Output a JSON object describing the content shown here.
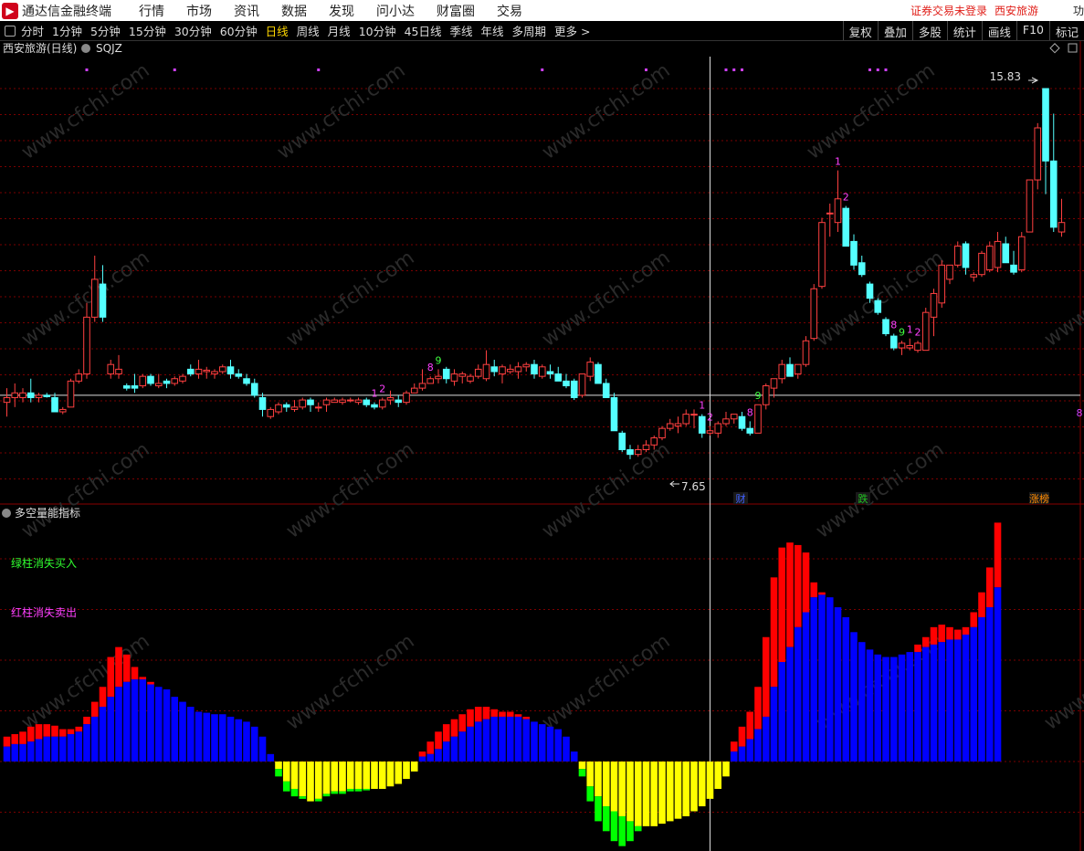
{
  "app": {
    "name": "通达信金融终端",
    "logo": "logo-icon"
  },
  "menu": [
    "行情",
    "市场",
    "资讯",
    "数据",
    "发现",
    "问小达",
    "财富圈",
    "交易"
  ],
  "status": {
    "login": "证券交易未登录",
    "stock": "西安旅游",
    "cut": "功"
  },
  "periods": [
    "分时",
    "1分钟",
    "5分钟",
    "15分钟",
    "30分钟",
    "60分钟",
    "日线",
    "周线",
    "月线",
    "10分钟",
    "45日线",
    "季线",
    "年线",
    "多周期",
    "更多 >"
  ],
  "active_period": "日线",
  "tools": [
    "复权",
    "叠加",
    "多股",
    "统计",
    "画线",
    "F10",
    "标记"
  ],
  "main_panel": {
    "title": "西安旅游(日线)",
    "indicator": "SQJZ",
    "high_label": "15.83",
    "low_label": "7.65",
    "markers": [
      "财",
      "跌",
      "涨榜"
    ],
    "right_edge_label": "8"
  },
  "sub_panel": {
    "title": "多空量能指标",
    "legend_green": "绿柱消失买入",
    "legend_red": "红柱消失卖出"
  },
  "watermark": "www.cfchi.com",
  "colors": {
    "up": "#ff4040",
    "down": "#54ffff",
    "bar_red": "#ff0000",
    "bar_blue": "#0000ff",
    "bar_yellow": "#ffff00",
    "bar_green": "#00ff00",
    "active": "#ffd700",
    "grid": "#7a0000"
  },
  "chart_data": {
    "type": "candlestick",
    "candles": [
      [
        9.2,
        9.5,
        8.9,
        9.3
      ],
      [
        9.3,
        9.6,
        9.1,
        9.4
      ],
      [
        9.3,
        9.5,
        9.2,
        9.4
      ],
      [
        9.4,
        9.7,
        9.2,
        9.3
      ],
      [
        9.3,
        9.4,
        9.2,
        9.35
      ],
      [
        9.35,
        9.4,
        9.3,
        9.32
      ],
      [
        9.3,
        9.4,
        9.0,
        9.0
      ],
      [
        9.0,
        9.1,
        8.95,
        9.05
      ],
      [
        9.1,
        9.7,
        9.1,
        9.65
      ],
      [
        9.65,
        9.9,
        9.6,
        9.8
      ],
      [
        9.8,
        11.3,
        9.7,
        11.0
      ],
      [
        11.0,
        12.3,
        10.9,
        11.8
      ],
      [
        11.7,
        12.1,
        10.9,
        11.0
      ],
      [
        9.8,
        10.1,
        9.7,
        10.0
      ],
      [
        9.8,
        10.2,
        9.7,
        9.9
      ],
      [
        9.55,
        9.6,
        9.45,
        9.5
      ],
      [
        9.55,
        9.8,
        9.4,
        9.5
      ],
      [
        9.55,
        9.8,
        9.5,
        9.75
      ],
      [
        9.75,
        9.8,
        9.55,
        9.6
      ],
      [
        9.55,
        9.8,
        9.5,
        9.6
      ],
      [
        9.65,
        9.7,
        9.5,
        9.6
      ],
      [
        9.6,
        9.75,
        9.55,
        9.7
      ],
      [
        9.65,
        9.8,
        9.6,
        9.75
      ],
      [
        9.9,
        10.0,
        9.75,
        9.8
      ],
      [
        9.8,
        10.1,
        9.7,
        9.9
      ],
      [
        9.85,
        9.95,
        9.7,
        9.88
      ],
      [
        9.8,
        9.9,
        9.7,
        9.85
      ],
      [
        9.85,
        10.0,
        9.8,
        9.95
      ],
      [
        9.95,
        10.1,
        9.7,
        9.8
      ],
      [
        9.8,
        9.9,
        9.7,
        9.75
      ],
      [
        9.7,
        9.8,
        9.55,
        9.6
      ],
      [
        9.6,
        9.7,
        9.3,
        9.35
      ],
      [
        9.3,
        9.4,
        8.9,
        9.05
      ],
      [
        8.9,
        9.1,
        8.85,
        9.05
      ],
      [
        9.0,
        9.2,
        8.95,
        9.15
      ],
      [
        9.15,
        9.2,
        9.0,
        9.1
      ],
      [
        9.05,
        9.25,
        9.0,
        9.1
      ],
      [
        9.1,
        9.3,
        9.05,
        9.25
      ],
      [
        9.25,
        9.3,
        9.0,
        9.15
      ],
      [
        9.1,
        9.2,
        9.0,
        9.1
      ],
      [
        9.15,
        9.3,
        9.0,
        9.25
      ],
      [
        9.2,
        9.3,
        9.2,
        9.25
      ],
      [
        9.2,
        9.3,
        9.15,
        9.25
      ],
      [
        9.25,
        9.3,
        9.2,
        9.25
      ],
      [
        9.2,
        9.3,
        9.15,
        9.25
      ],
      [
        9.25,
        9.3,
        9.1,
        9.15
      ],
      [
        9.15,
        9.2,
        9.05,
        9.1
      ],
      [
        9.1,
        9.3,
        9.05,
        9.25
      ],
      [
        9.25,
        9.45,
        9.15,
        9.3
      ],
      [
        9.25,
        9.35,
        9.1,
        9.2
      ],
      [
        9.2,
        9.45,
        9.15,
        9.4
      ],
      [
        9.4,
        9.6,
        9.4,
        9.5
      ],
      [
        9.5,
        9.9,
        9.45,
        9.6
      ],
      [
        9.6,
        9.75,
        9.6,
        9.7
      ],
      [
        9.7,
        9.9,
        9.6,
        9.75
      ],
      [
        9.9,
        9.95,
        9.6,
        9.7
      ],
      [
        9.65,
        9.9,
        9.55,
        9.8
      ],
      [
        9.75,
        9.85,
        9.6,
        9.8
      ],
      [
        9.65,
        9.8,
        9.6,
        9.75
      ],
      [
        9.75,
        10.0,
        9.7,
        9.9
      ],
      [
        9.7,
        10.3,
        9.65,
        10.0
      ],
      [
        9.95,
        10.1,
        9.75,
        9.85
      ],
      [
        9.8,
        10.0,
        9.6,
        9.95
      ],
      [
        9.85,
        10.0,
        9.8,
        9.9
      ],
      [
        9.85,
        10.05,
        9.7,
        9.95
      ],
      [
        9.95,
        10.05,
        9.85,
        10.0
      ],
      [
        10.0,
        10.1,
        9.7,
        9.8
      ],
      [
        9.75,
        10.0,
        9.7,
        9.95
      ],
      [
        9.85,
        10.0,
        9.7,
        9.8
      ],
      [
        9.8,
        9.95,
        9.65,
        9.65
      ],
      [
        9.65,
        9.8,
        9.5,
        9.55
      ],
      [
        9.65,
        9.7,
        9.25,
        9.3
      ],
      [
        9.35,
        9.8,
        9.3,
        9.8
      ],
      [
        9.75,
        10.15,
        9.65,
        10.05
      ],
      [
        10.0,
        10.05,
        9.6,
        9.6
      ],
      [
        9.6,
        9.7,
        9.3,
        9.3
      ],
      [
        9.3,
        9.4,
        8.6,
        8.6
      ],
      [
        8.55,
        8.6,
        8.15,
        8.2
      ],
      [
        8.2,
        8.3,
        8.0,
        8.1
      ],
      [
        8.1,
        8.3,
        8.05,
        8.2
      ],
      [
        8.2,
        8.4,
        8.15,
        8.3
      ],
      [
        8.3,
        8.5,
        8.2,
        8.45
      ],
      [
        8.45,
        8.7,
        8.4,
        8.65
      ],
      [
        8.65,
        8.85,
        8.6,
        8.75
      ],
      [
        8.7,
        8.9,
        8.55,
        8.75
      ],
      [
        8.75,
        9.05,
        8.7,
        8.95
      ],
      [
        8.95,
        9.05,
        8.65,
        8.95
      ],
      [
        8.9,
        8.95,
        8.45,
        8.55
      ],
      [
        8.55,
        8.7,
        8.5,
        8.6
      ],
      [
        8.55,
        8.8,
        8.45,
        8.75
      ],
      [
        8.75,
        9.0,
        8.7,
        8.85
      ],
      [
        8.85,
        8.95,
        8.75,
        8.95
      ],
      [
        8.9,
        9.0,
        8.6,
        8.65
      ],
      [
        8.65,
        8.8,
        8.5,
        8.55
      ],
      [
        8.55,
        9.15,
        8.55,
        9.15
      ],
      [
        9.15,
        9.6,
        9.05,
        9.55
      ],
      [
        9.5,
        9.7,
        9.3,
        9.7
      ],
      [
        9.7,
        10.1,
        9.6,
        10.0
      ],
      [
        10.0,
        10.15,
        9.75,
        9.75
      ],
      [
        9.8,
        10.0,
        9.7,
        10.0
      ],
      [
        10.0,
        10.6,
        9.95,
        10.5
      ],
      [
        10.55,
        11.7,
        10.5,
        11.6
      ],
      [
        11.65,
        13.1,
        11.6,
        13.0
      ],
      [
        13.2,
        13.4,
        12.7,
        13.2
      ],
      [
        13.0,
        14.1,
        12.8,
        13.5
      ],
      [
        13.3,
        13.35,
        12.5,
        12.5
      ],
      [
        12.6,
        12.75,
        12.0,
        12.1
      ],
      [
        12.15,
        12.3,
        11.85,
        11.9
      ],
      [
        11.7,
        11.75,
        11.3,
        11.4
      ],
      [
        11.35,
        11.4,
        11.05,
        11.1
      ],
      [
        10.95,
        11.0,
        10.6,
        10.65
      ],
      [
        10.6,
        10.65,
        10.3,
        10.35
      ],
      [
        10.35,
        10.5,
        10.2,
        10.45
      ],
      [
        10.35,
        10.55,
        10.3,
        10.4
      ],
      [
        10.3,
        10.5,
        10.25,
        10.45
      ],
      [
        10.3,
        11.2,
        10.3,
        11.1
      ],
      [
        11.0,
        11.6,
        10.6,
        11.5
      ],
      [
        11.3,
        12.2,
        11.2,
        12.1
      ],
      [
        11.8,
        12.1,
        11.7,
        12.1
      ],
      [
        12.1,
        12.6,
        12.05,
        12.5
      ],
      [
        12.55,
        12.6,
        11.9,
        12.05
      ],
      [
        11.85,
        11.95,
        11.75,
        11.9
      ],
      [
        11.9,
        12.4,
        11.85,
        12.35
      ],
      [
        12.0,
        12.6,
        11.95,
        12.5
      ],
      [
        12.05,
        12.8,
        11.95,
        12.6
      ],
      [
        12.55,
        12.7,
        12.15,
        12.15
      ],
      [
        12.1,
        12.4,
        11.9,
        11.95
      ],
      [
        12.0,
        12.8,
        11.95,
        12.7
      ],
      [
        12.8,
        13.9,
        12.8,
        13.9
      ],
      [
        13.9,
        15.1,
        13.7,
        15.0
      ],
      [
        15.83,
        15.83,
        13.6,
        14.3
      ],
      [
        14.3,
        15.3,
        12.8,
        12.9
      ],
      [
        12.8,
        13.5,
        12.7,
        13.0
      ]
    ],
    "x_label_marks": [
      {
        "i": 46,
        "t": "1",
        "c": "#ff40ff"
      },
      {
        "i": 47,
        "t": "2",
        "c": "#ff40ff"
      },
      {
        "i": 53,
        "t": "8",
        "c": "#ff40ff"
      },
      {
        "i": 54,
        "t": "9",
        "c": "#40ff40"
      },
      {
        "i": 87,
        "t": "1",
        "c": "#ff40ff"
      },
      {
        "i": 88,
        "t": "2",
        "c": "#ff40ff"
      },
      {
        "i": 93,
        "t": "8",
        "c": "#ff40ff"
      },
      {
        "i": 94,
        "t": "9",
        "c": "#40ff40"
      },
      {
        "i": 104,
        "t": "1",
        "c": "#ff40ff"
      },
      {
        "i": 105,
        "t": "2",
        "c": "#ff40ff"
      },
      {
        "i": 111,
        "t": "8",
        "c": "#ff40ff"
      },
      {
        "i": 112,
        "t": "9",
        "c": "#40ff40"
      },
      {
        "i": 113,
        "t": "1",
        "c": "#ff40ff"
      },
      {
        "i": 114,
        "t": "2",
        "c": "#ff40ff"
      }
    ],
    "top_dots": [
      10,
      21,
      39,
      67,
      80,
      90,
      91,
      92,
      108,
      109,
      110
    ],
    "price_line": 9.35,
    "cursor_index": 88,
    "volume_energy": [
      [
        0.5,
        0.3
      ],
      [
        0.55,
        0.35
      ],
      [
        0.6,
        0.35
      ],
      [
        0.7,
        0.4
      ],
      [
        0.75,
        0.45
      ],
      [
        0.75,
        0.5
      ],
      [
        0.72,
        0.5
      ],
      [
        0.65,
        0.5
      ],
      [
        0.65,
        0.55
      ],
      [
        0.7,
        0.6
      ],
      [
        0.9,
        0.75
      ],
      [
        1.2,
        0.9
      ],
      [
        1.5,
        1.1
      ],
      [
        2.1,
        1.3
      ],
      [
        2.3,
        1.5
      ],
      [
        2.15,
        1.6
      ],
      [
        1.9,
        1.65
      ],
      [
        1.7,
        1.65
      ],
      [
        1.6,
        1.55
      ],
      [
        1.5,
        1.5
      ],
      [
        1.45,
        1.45
      ],
      [
        1.3,
        1.3
      ],
      [
        1.2,
        1.2
      ],
      [
        1.1,
        1.1
      ],
      [
        1.0,
        1.0
      ],
      [
        0.98,
        0.98
      ],
      [
        0.95,
        0.95
      ],
      [
        0.95,
        0.95
      ],
      [
        0.9,
        0.9
      ],
      [
        0.85,
        0.85
      ],
      [
        0.8,
        0.8
      ],
      [
        0.7,
        0.7
      ],
      [
        0.5,
        0.5
      ],
      [
        0.15,
        0.15
      ],
      [
        -0.3,
        -0.15
      ],
      [
        -0.6,
        -0.4
      ],
      [
        -0.7,
        -0.55
      ],
      [
        -0.75,
        -0.7
      ],
      [
        -0.8,
        -0.8
      ],
      [
        -0.8,
        -0.75
      ],
      [
        -0.7,
        -0.65
      ],
      [
        -0.65,
        -0.6
      ],
      [
        -0.65,
        -0.6
      ],
      [
        -0.6,
        -0.55
      ],
      [
        -0.6,
        -0.55
      ],
      [
        -0.58,
        -0.55
      ],
      [
        -0.55,
        -0.55
      ],
      [
        -0.55,
        -0.55
      ],
      [
        -0.5,
        -0.5
      ],
      [
        -0.45,
        -0.45
      ],
      [
        -0.35,
        -0.35
      ],
      [
        -0.2,
        -0.2
      ],
      [
        0.2,
        0.1
      ],
      [
        0.4,
        0.15
      ],
      [
        0.6,
        0.25
      ],
      [
        0.75,
        0.4
      ],
      [
        0.85,
        0.5
      ],
      [
        0.95,
        0.6
      ],
      [
        1.05,
        0.7
      ],
      [
        1.1,
        0.8
      ],
      [
        1.1,
        0.85
      ],
      [
        1.05,
        0.9
      ],
      [
        1.0,
        0.9
      ],
      [
        1.0,
        0.9
      ],
      [
        0.95,
        0.9
      ],
      [
        0.9,
        0.85
      ],
      [
        0.8,
        0.8
      ],
      [
        0.75,
        0.75
      ],
      [
        0.7,
        0.7
      ],
      [
        0.65,
        0.65
      ],
      [
        0.5,
        0.5
      ],
      [
        0.2,
        0.2
      ],
      [
        -0.3,
        -0.15
      ],
      [
        -0.8,
        -0.5
      ],
      [
        -1.2,
        -0.7
      ],
      [
        -1.4,
        -0.9
      ],
      [
        -1.6,
        -1.0
      ],
      [
        -1.7,
        -1.1
      ],
      [
        -1.6,
        -1.2
      ],
      [
        -1.4,
        -1.3
      ],
      [
        -1.3,
        -1.3
      ],
      [
        -1.3,
        -1.3
      ],
      [
        -1.25,
        -1.25
      ],
      [
        -1.2,
        -1.2
      ],
      [
        -1.15,
        -1.15
      ],
      [
        -1.1,
        -1.1
      ],
      [
        -1.0,
        -1.0
      ],
      [
        -0.9,
        -0.9
      ],
      [
        -0.75,
        -0.75
      ],
      [
        -0.55,
        -0.55
      ],
      [
        -0.3,
        -0.3
      ],
      [
        0.4,
        0.2
      ],
      [
        0.7,
        0.3
      ],
      [
        1.0,
        0.45
      ],
      [
        1.5,
        0.65
      ],
      [
        2.5,
        0.9
      ],
      [
        3.7,
        1.5
      ],
      [
        4.3,
        2.0
      ],
      [
        4.4,
        2.3
      ],
      [
        4.35,
        2.7
      ],
      [
        4.2,
        3.0
      ],
      [
        3.6,
        3.3
      ],
      [
        3.4,
        3.35
      ],
      [
        3.3,
        3.3
      ],
      [
        3.1,
        3.1
      ],
      [
        2.9,
        2.9
      ],
      [
        2.6,
        2.6
      ],
      [
        2.4,
        2.4
      ],
      [
        2.25,
        2.25
      ],
      [
        2.15,
        2.15
      ],
      [
        2.1,
        2.1
      ],
      [
        2.1,
        2.1
      ],
      [
        2.15,
        2.15
      ],
      [
        2.2,
        2.2
      ],
      [
        2.35,
        2.2
      ],
      [
        2.5,
        2.3
      ],
      [
        2.7,
        2.35
      ],
      [
        2.75,
        2.4
      ],
      [
        2.7,
        2.45
      ],
      [
        2.65,
        2.45
      ],
      [
        2.7,
        2.55
      ],
      [
        3.0,
        2.7
      ],
      [
        3.4,
        2.9
      ],
      [
        3.9,
        3.1
      ],
      [
        4.8,
        3.5
      ]
    ]
  }
}
